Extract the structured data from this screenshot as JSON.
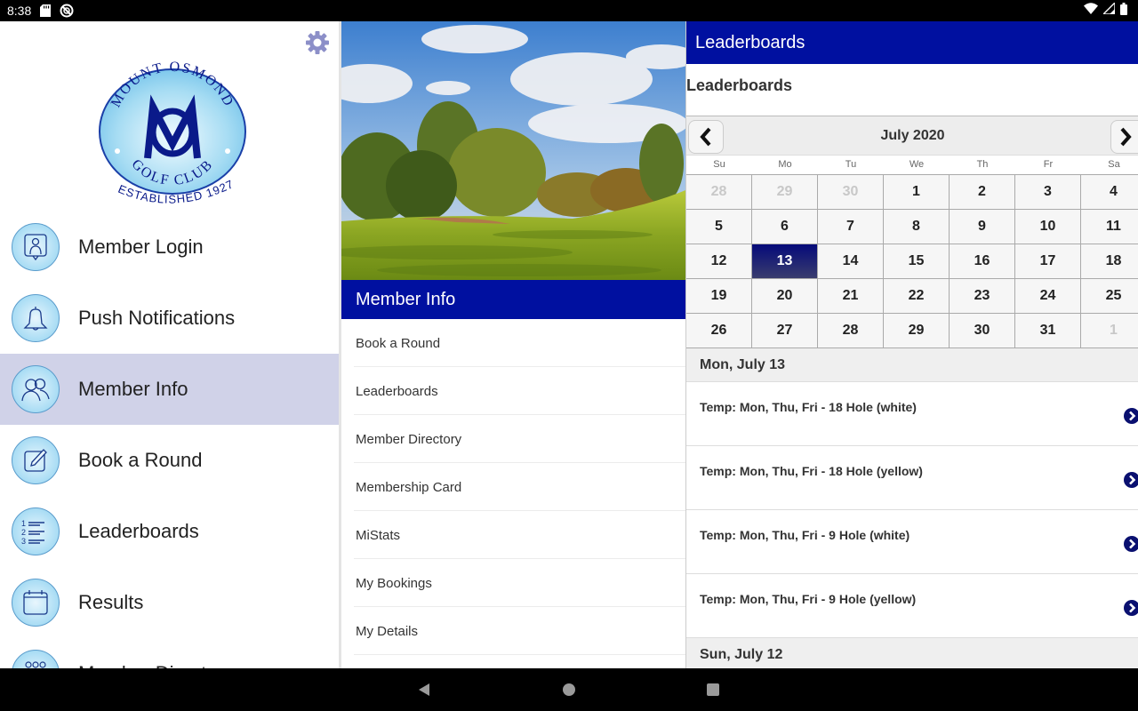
{
  "status_bar": {
    "time": "8:38",
    "icons": [
      "sd-card-icon",
      "do-not-disturb-icon"
    ],
    "right_icons": [
      "wifi-icon",
      "cellular-signal-icon",
      "battery-icon"
    ]
  },
  "drawer": {
    "settings_icon": "gear-icon",
    "logo": {
      "top_text": "MOUNT OSMOND",
      "bottom_text": "GOLF CLUB",
      "established": "ESTABLISHED 1927",
      "monogram": "MO"
    },
    "items": [
      {
        "label": "Member Login",
        "icon": "member-login-icon",
        "active": false
      },
      {
        "label": "Push Notifications",
        "icon": "bell-icon",
        "active": false
      },
      {
        "label": "Member Info",
        "icon": "members-icon",
        "active": true
      },
      {
        "label": "Book a Round",
        "icon": "pencil-icon",
        "active": false
      },
      {
        "label": "Leaderboards",
        "icon": "numbered-list-icon",
        "active": false
      },
      {
        "label": "Results",
        "icon": "calendar-icon",
        "active": false
      },
      {
        "label": "Member Directory",
        "icon": "group-icon",
        "active": false
      }
    ]
  },
  "middle": {
    "header": "Member Info",
    "items": [
      "Book a Round",
      "Leaderboards",
      "Member Directory",
      "Membership Card",
      "MiStats",
      "My Bookings",
      "My Details"
    ]
  },
  "right": {
    "header": "Leaderboards",
    "title": "Leaderboards",
    "calendar": {
      "month": "July 2020",
      "prev_icon": "chevron-left-icon",
      "next_icon": "chevron-right-icon",
      "weekdays": [
        "Su",
        "Mo",
        "Tu",
        "We",
        "Th",
        "Fr",
        "Sa"
      ],
      "days": [
        {
          "d": "28",
          "other": true
        },
        {
          "d": "29",
          "other": true
        },
        {
          "d": "30",
          "other": true
        },
        {
          "d": "1"
        },
        {
          "d": "2"
        },
        {
          "d": "3"
        },
        {
          "d": "4"
        },
        {
          "d": "5"
        },
        {
          "d": "6"
        },
        {
          "d": "7"
        },
        {
          "d": "8"
        },
        {
          "d": "9"
        },
        {
          "d": "10"
        },
        {
          "d": "11"
        },
        {
          "d": "12"
        },
        {
          "d": "13",
          "selected": true
        },
        {
          "d": "14"
        },
        {
          "d": "15"
        },
        {
          "d": "16"
        },
        {
          "d": "17"
        },
        {
          "d": "18"
        },
        {
          "d": "19"
        },
        {
          "d": "20"
        },
        {
          "d": "21"
        },
        {
          "d": "22"
        },
        {
          "d": "23"
        },
        {
          "d": "24"
        },
        {
          "d": "25"
        },
        {
          "d": "26"
        },
        {
          "d": "27"
        },
        {
          "d": "28"
        },
        {
          "d": "29"
        },
        {
          "d": "30"
        },
        {
          "d": "31"
        },
        {
          "d": "1",
          "other": true
        }
      ],
      "selected_color": "#050a7a"
    },
    "day_groups": [
      {
        "date": "Mon, July 13",
        "events": [
          "Temp: Mon, Thu, Fri - 18 Hole (white)",
          "Temp: Mon, Thu, Fri - 18 Hole (yellow)",
          "Temp: Mon, Thu, Fri - 9 Hole (white)",
          "Temp: Mon, Thu, Fri - 9 Hole (yellow)"
        ]
      },
      {
        "date": "Sun, July 12",
        "events": []
      }
    ]
  },
  "nav_bar": {
    "buttons": [
      "back-icon",
      "home-icon",
      "recents-icon"
    ]
  },
  "colors": {
    "brand_blue": "#0010a0",
    "drawer_active": "#d0d2e8",
    "arrow_navy": "#0a1070"
  }
}
